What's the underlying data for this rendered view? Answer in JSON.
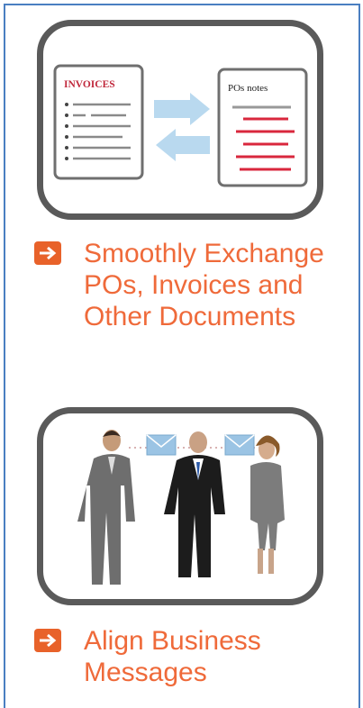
{
  "features": [
    {
      "title": "Smoothly Exchange\nPOs, Invoices and\nOther Documents",
      "left_doc_label": "INVOICES",
      "right_doc_label": "POs notes",
      "colors": {
        "accent": "#e8622a",
        "text": "#ef6a3a",
        "left_doc_title": "#c0283c",
        "right_doc_lines": "#d9273d",
        "arrows": "#b9d9ef"
      }
    },
    {
      "title": "Align Business\nMessages",
      "colors": {
        "envelope": "#9bc4e4"
      }
    }
  ],
  "icons": {
    "bullet_arrow": "arrow-right-icon",
    "exchange_arrows": "exchange-arrows-icon",
    "envelope": "envelope-icon"
  },
  "frame_color": "#4a7fc1",
  "card_border_color": "#5a5a5a"
}
